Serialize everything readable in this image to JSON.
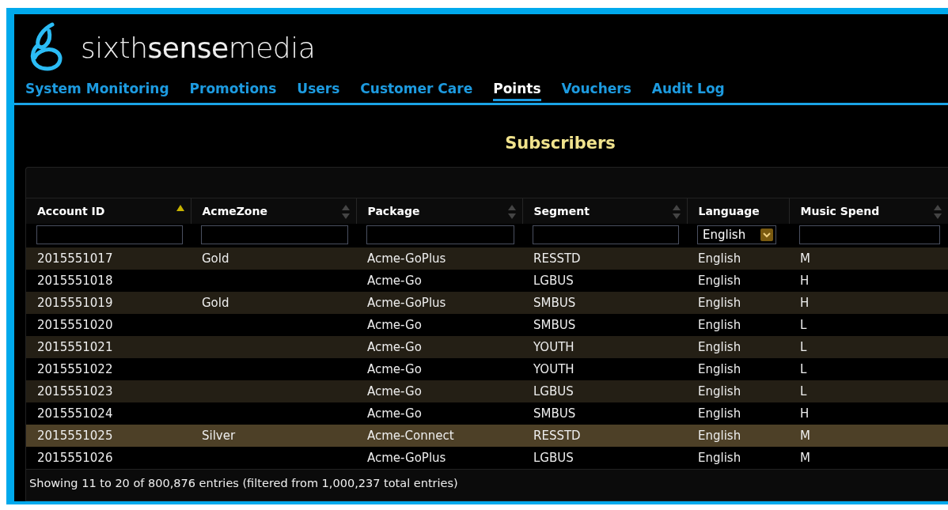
{
  "logo": {
    "text": "sixth**sense**media"
  },
  "nav": [
    {
      "label": "System Monitoring",
      "selected": false
    },
    {
      "label": "Promotions",
      "selected": false
    },
    {
      "label": "Users",
      "selected": false
    },
    {
      "label": "Customer Care",
      "selected": false
    },
    {
      "label": "Points",
      "selected": true
    },
    {
      "label": "Vouchers",
      "selected": false
    },
    {
      "label": "Audit Log",
      "selected": false
    }
  ],
  "title": "Subscribers",
  "table": {
    "columns": [
      {
        "label": "Account ID",
        "kind": "ascending",
        "filter": {
          "kind": "text"
        }
      },
      {
        "label": "AcmeZone",
        "kind": "sortable",
        "filter": {
          "kind": "text"
        }
      },
      {
        "label": "Package",
        "kind": "sortable",
        "filter": {
          "kind": "text"
        }
      },
      {
        "label": "Segment",
        "kind": "sortable",
        "filter": {
          "kind": "text"
        }
      },
      {
        "label": "Language",
        "kind": "plain",
        "filter": {
          "kind": "select",
          "value": "English"
        }
      },
      {
        "label": "Music Spend",
        "kind": "sortable",
        "filter": {
          "kind": "text"
        }
      }
    ],
    "rows": [
      {
        "selected": false,
        "cells": [
          "2015551017",
          "Gold",
          "Acme-GoPlus",
          "RESSTD",
          "English",
          "M"
        ]
      },
      {
        "selected": false,
        "cells": [
          "2015551018",
          "",
          "Acme-Go",
          "LGBUS",
          "English",
          "H"
        ]
      },
      {
        "selected": false,
        "cells": [
          "2015551019",
          "Gold",
          "Acme-GoPlus",
          "SMBUS",
          "English",
          "H"
        ]
      },
      {
        "selected": false,
        "cells": [
          "2015551020",
          "",
          "Acme-Go",
          "SMBUS",
          "English",
          "L"
        ]
      },
      {
        "selected": false,
        "cells": [
          "2015551021",
          "",
          "Acme-Go",
          "YOUTH",
          "English",
          "L"
        ]
      },
      {
        "selected": false,
        "cells": [
          "2015551022",
          "",
          "Acme-Go",
          "YOUTH",
          "English",
          "L"
        ]
      },
      {
        "selected": false,
        "cells": [
          "2015551023",
          "",
          "Acme-Go",
          "LGBUS",
          "English",
          "L"
        ]
      },
      {
        "selected": false,
        "cells": [
          "2015551024",
          "",
          "Acme-Go",
          "SMBUS",
          "English",
          "H"
        ]
      },
      {
        "selected": true,
        "cells": [
          "2015551025",
          "Silver",
          "Acme-Connect",
          "RESSTD",
          "English",
          "M"
        ]
      },
      {
        "selected": false,
        "cells": [
          "2015551026",
          "",
          "Acme-GoPlus",
          "LGBUS",
          "English",
          "M"
        ]
      }
    ],
    "info": "Showing 11 to 20 of 800,876 entries (filtered from 1,000,237 total entries)"
  }
}
